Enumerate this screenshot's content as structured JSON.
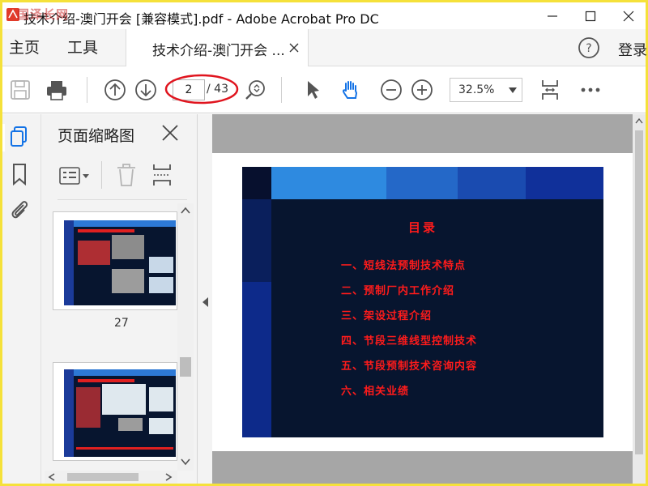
{
  "window": {
    "title": "技术介绍-澳门开会 [兼容模式].pdf - Adobe Acrobat Pro DC",
    "watermark": "国泽长网"
  },
  "menubar": {
    "home": "主页",
    "tools": "工具",
    "doc_tab": "技术介绍-澳门开会 ...",
    "login": "登录"
  },
  "toolbar": {
    "current_page": "2",
    "total_pages": "/ 43",
    "zoom": "32.5%"
  },
  "thumb_pane": {
    "title": "页面缩略图",
    "thumbnails": [
      {
        "page": "27"
      },
      {
        "page": ""
      }
    ]
  },
  "slide": {
    "title": "目录",
    "items": [
      "一、短线法预制技术特点",
      "二、预制厂内工作介绍",
      "三、架设过程介绍",
      "四、节段三维线型控制技术",
      "五、节段预制技术咨询内容",
      "六、相关业绩"
    ]
  },
  "colors": {
    "accent_blue": "#1473e6",
    "annotation_red": "#e0141e",
    "slide_text": "#ff1b1b",
    "slide_bg": "#07152f"
  }
}
